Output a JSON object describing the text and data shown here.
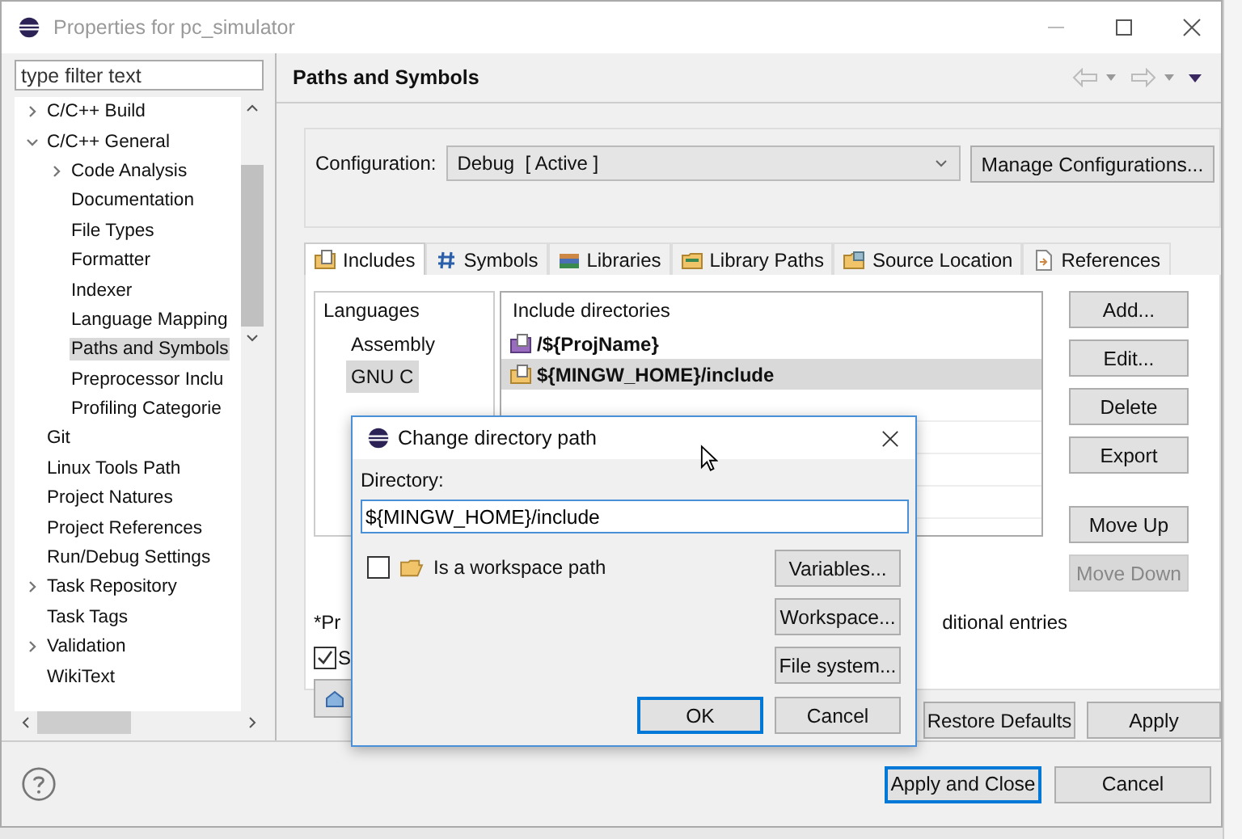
{
  "window": {
    "title": "Properties for pc_simulator"
  },
  "filter": {
    "placeholder": "type filter text"
  },
  "tree": [
    {
      "label": "C/C++ Build",
      "expanded": false,
      "selected": false
    },
    {
      "label": "C/C++ General",
      "expanded": true,
      "selected": false,
      "children": [
        {
          "label": "Code Analysis",
          "expanded": false,
          "selected": false
        },
        {
          "label": "Documentation",
          "selected": false
        },
        {
          "label": "File Types",
          "selected": false
        },
        {
          "label": "Formatter",
          "selected": false
        },
        {
          "label": "Indexer",
          "selected": false
        },
        {
          "label": "Language Mapping",
          "selected": false
        },
        {
          "label": "Paths and Symbols",
          "selected": true
        },
        {
          "label": "Preprocessor Inclu",
          "selected": false
        },
        {
          "label": "Profiling Categorie",
          "selected": false
        }
      ]
    },
    {
      "label": "Git",
      "selected": false
    },
    {
      "label": "Linux Tools Path",
      "selected": false
    },
    {
      "label": "Project Natures",
      "selected": false
    },
    {
      "label": "Project References",
      "selected": false
    },
    {
      "label": "Run/Debug Settings",
      "selected": false
    },
    {
      "label": "Task Repository",
      "expanded": false,
      "selected": false
    },
    {
      "label": "Task Tags",
      "selected": false
    },
    {
      "label": "Validation",
      "expanded": false,
      "selected": false
    },
    {
      "label": "WikiText",
      "selected": false
    }
  ],
  "page": {
    "title": "Paths and Symbols"
  },
  "configuration": {
    "label": "Configuration:",
    "value": "Debug  [ Active ]",
    "manage_button": "Manage Configurations..."
  },
  "tabs": [
    {
      "label": "Includes",
      "kind": "include",
      "selected": true
    },
    {
      "label": "Symbols",
      "kind": "hash",
      "selected": false
    },
    {
      "label": "Libraries",
      "kind": "books",
      "selected": false
    },
    {
      "label": "Library Paths",
      "kind": "folder-books",
      "selected": false
    },
    {
      "label": "Source Location",
      "kind": "folder-source",
      "selected": false
    },
    {
      "label": "References",
      "kind": "references",
      "selected": false
    }
  ],
  "languages": {
    "heading": "Languages",
    "items": [
      {
        "label": "Assembly",
        "selected": false
      },
      {
        "label": "GNU C",
        "selected": true
      }
    ]
  },
  "include_directories": {
    "heading": "Include directories",
    "items": [
      {
        "label": "/${ProjName}",
        "kind": "workspace",
        "selected": false
      },
      {
        "label": "${MINGW_HOME}/include",
        "kind": "filesystem",
        "selected": true
      }
    ]
  },
  "side_buttons": [
    {
      "label": "Add...",
      "disabled": false
    },
    {
      "label": "Edit...",
      "disabled": false
    },
    {
      "label": "Delete",
      "disabled": false
    },
    {
      "label": "Export",
      "disabled": false
    },
    {
      "label": "Move Up",
      "disabled": false
    },
    {
      "label": "Move Down",
      "disabled": true
    }
  ],
  "note": {
    "left": "*Pr",
    "right": "ditional entries"
  },
  "show_checkbox": {
    "label": "S",
    "checked": true
  },
  "restore_defaults": "Restore Defaults",
  "apply": "Apply",
  "apply_and_close": "Apply and Close",
  "cancel": "Cancel",
  "dialog": {
    "title": "Change directory path",
    "label": "Directory:",
    "value": "${MINGW_HOME}/include",
    "workspace_checkbox": {
      "label": "Is a workspace path",
      "checked": false
    },
    "buttons": [
      "Variables...",
      "Workspace...",
      "File system..."
    ],
    "ok": "OK",
    "cancel": "Cancel"
  }
}
